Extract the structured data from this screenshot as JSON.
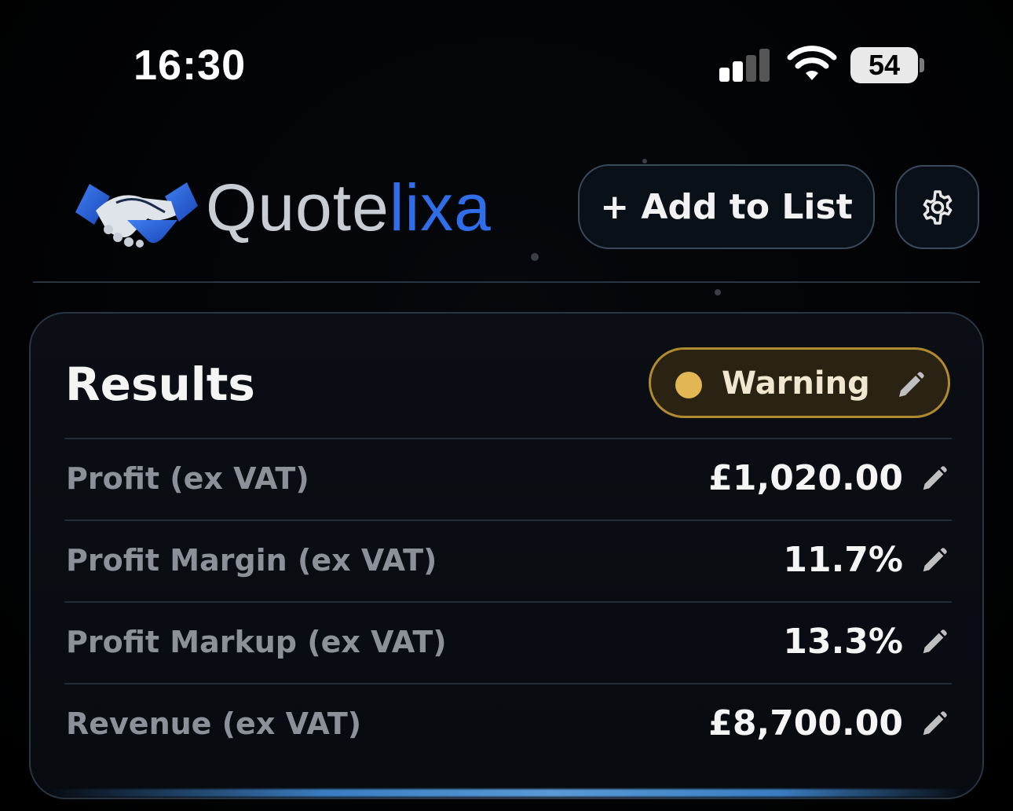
{
  "status_bar": {
    "time": "16:30",
    "battery_level": "54",
    "signal_bars_active": 2,
    "signal_bars_total": 4
  },
  "header": {
    "logo_text_part1": "Quote",
    "logo_text_part2": "lixa",
    "logo_icon": "handshake-icon",
    "add_button_label": "+ Add to List",
    "settings_icon": "gear-icon"
  },
  "results": {
    "title": "Results",
    "status": {
      "label": "Warning",
      "color": "#e2b652",
      "icon": "pencil-icon"
    },
    "rows": [
      {
        "label": "Profit (ex VAT)",
        "value": "£1,020.00"
      },
      {
        "label": "Profit Margin (ex VAT)",
        "value": "11.7%"
      },
      {
        "label": "Profit Markup (ex VAT)",
        "value": "13.3%"
      },
      {
        "label": "Revenue (ex VAT)",
        "value": "£8,700.00"
      }
    ]
  },
  "colors": {
    "accent_blue": "#2f6ee8",
    "warning_gold": "#b08a2e",
    "background": "#000000"
  }
}
